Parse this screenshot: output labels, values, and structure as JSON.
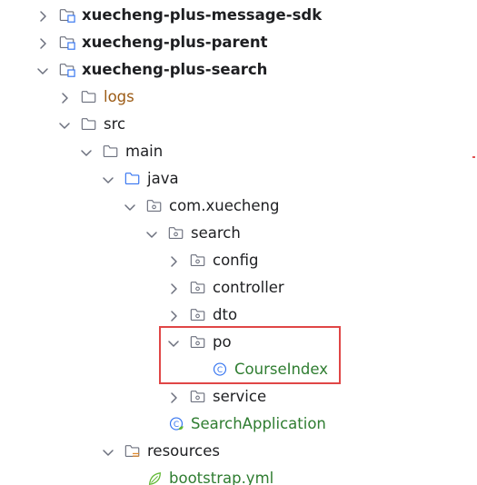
{
  "project_tree": {
    "items": [
      {
        "label": "xuecheng-plus-message-sdk",
        "type": "module",
        "expanded": false,
        "style": "bold"
      },
      {
        "label": "xuecheng-plus-parent",
        "type": "module",
        "expanded": false,
        "style": "bold"
      },
      {
        "label": "xuecheng-plus-search",
        "type": "module",
        "expanded": true,
        "style": "bold"
      },
      {
        "label": "logs",
        "type": "folder",
        "expanded": false,
        "style": "orange"
      },
      {
        "label": "src",
        "type": "folder",
        "expanded": true,
        "style": "normal"
      },
      {
        "label": "main",
        "type": "folder",
        "expanded": true,
        "style": "normal"
      },
      {
        "label": "java",
        "type": "source-folder",
        "expanded": true,
        "style": "normal"
      },
      {
        "label": "com.xuecheng",
        "type": "package",
        "expanded": true,
        "style": "normal"
      },
      {
        "label": "search",
        "type": "package",
        "expanded": true,
        "style": "normal"
      },
      {
        "label": "config",
        "type": "package",
        "expanded": false,
        "style": "normal"
      },
      {
        "label": "controller",
        "type": "package",
        "expanded": false,
        "style": "normal"
      },
      {
        "label": "dto",
        "type": "package",
        "expanded": false,
        "style": "normal"
      },
      {
        "label": "po",
        "type": "package",
        "expanded": true,
        "style": "normal"
      },
      {
        "label": "CourseIndex",
        "type": "class",
        "style": "green"
      },
      {
        "label": "service",
        "type": "package",
        "expanded": false,
        "style": "normal"
      },
      {
        "label": "SearchApplication",
        "type": "spring-class",
        "style": "green"
      },
      {
        "label": "resources",
        "type": "resources-folder",
        "expanded": true,
        "style": "normal"
      },
      {
        "label": "bootstrap.yml",
        "type": "yaml-file",
        "style": "green"
      }
    ]
  },
  "colors": {
    "text": "#1e1f22",
    "excluded_folder": "#9c5b15",
    "modified_file": "#2f7d31",
    "class_icon": "#3574f0",
    "highlight": "#e04646"
  }
}
